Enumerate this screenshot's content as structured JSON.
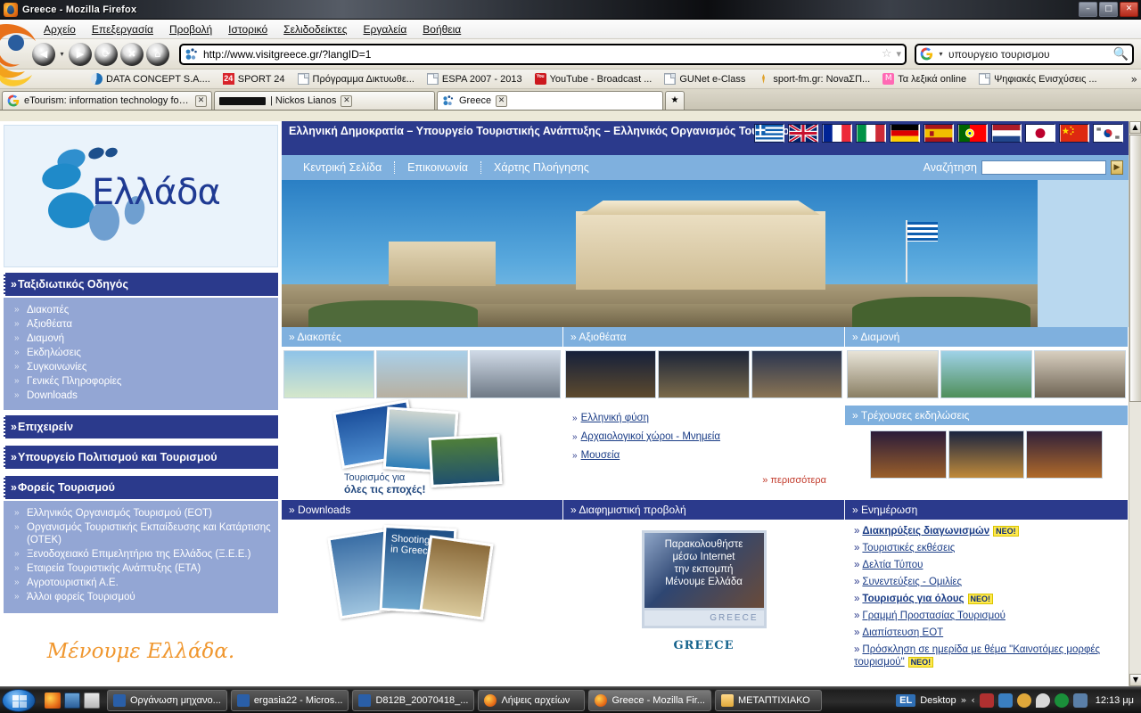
{
  "window": {
    "title": "Greece - Mozilla Firefox",
    "icon": "firefox-icon",
    "minimize": "–",
    "maximize": "□",
    "close": "✕"
  },
  "menubar": {
    "items": [
      {
        "label": "Αρχείο"
      },
      {
        "label": "Επεξεργασία"
      },
      {
        "label": "Προβολή"
      },
      {
        "label": "Ιστορικό"
      },
      {
        "label": "Σελιδοδείκτες"
      },
      {
        "label": "Εργαλεία"
      },
      {
        "label": "Βοήθεια"
      }
    ]
  },
  "navbar": {
    "back": "◀",
    "forward": "▶",
    "reload": "⟳",
    "stop": "✖",
    "home": "⌂",
    "url": "http://www.visitgreece.gr/?langID=1",
    "url_favicon": "visitgreece-favicon",
    "bookmark_star": "☆",
    "dropdown": "▾",
    "search_value": "υπουργειο τουρισμου",
    "search_engine_icon": "google-icon",
    "search_glyph": "🔍"
  },
  "bookmarks": {
    "items": [
      {
        "label": "DATA CONCEPT S.A....",
        "icon": "dataconcept-icon"
      },
      {
        "label": "SPORT 24",
        "icon": "sport24-icon"
      },
      {
        "label": "Πρόγραμμα Δικτυωθε...",
        "icon": "page-icon"
      },
      {
        "label": "ESPA 2007 - 2013",
        "icon": "page-icon"
      },
      {
        "label": "YouTube - Broadcast ...",
        "icon": "youtube-icon"
      },
      {
        "label": "GUNet e-Class",
        "icon": "page-icon"
      },
      {
        "label": "sport-fm.gr: ΝοvaΣΠ...",
        "icon": "pin-icon"
      },
      {
        "label": "Τα λεξικά online",
        "icon": "lexika-icon"
      },
      {
        "label": "Ψηφιακές Ενισχύσεις ...",
        "icon": "page-icon"
      }
    ],
    "overflow": "»"
  },
  "tabs": {
    "items": [
      {
        "label": "eTourism: information technology for ...",
        "active": false,
        "close": "✕",
        "redacted": false
      },
      {
        "label": "| Nickos Lianos",
        "active": false,
        "close": "✕",
        "redacted": true
      },
      {
        "label": "Greece",
        "active": true,
        "close": "✕",
        "redacted": false
      }
    ],
    "list_all": "★"
  },
  "site": {
    "logo_text": "Ελλάδα",
    "title": "Ελληνική Δημοκρατία – Υπουργείο Τουριστικής Ανάπτυξης – Ελληνικός Οργανισμός Τουρισμού",
    "flags": [
      {
        "name": "greece-flag"
      },
      {
        "name": "united-kingdom-flag"
      },
      {
        "name": "france-flag"
      },
      {
        "name": "italy-flag"
      },
      {
        "name": "germany-flag"
      },
      {
        "name": "spain-flag"
      },
      {
        "name": "portugal-flag"
      },
      {
        "name": "netherlands-flag"
      },
      {
        "name": "japan-flag"
      },
      {
        "name": "china-flag"
      },
      {
        "name": "south-korea-flag"
      }
    ],
    "topnav": [
      {
        "label": "Κεντρική Σελίδα"
      },
      {
        "label": "Επικοινωνία"
      },
      {
        "label": "Χάρτης Πλοήγησης"
      }
    ],
    "search_label": "Αναζήτηση",
    "search_value": "",
    "search_button": "▶",
    "slogan": "Μένουμε Ελλάδα."
  },
  "sidebar": {
    "sections": [
      {
        "title": "Ταξιδιωτικός Οδηγός",
        "chev": "»",
        "items": [
          {
            "label": "Διακοπές"
          },
          {
            "label": "Αξιοθέατα"
          },
          {
            "label": "Διαμονή"
          },
          {
            "label": "Εκδηλώσεις"
          },
          {
            "label": "Συγκοινωνίες"
          },
          {
            "label": "Γενικές Πληροφορίες"
          },
          {
            "label": "Downloads"
          }
        ]
      },
      {
        "title": "Επιχειρείν",
        "chev": "»",
        "items": []
      },
      {
        "title": "Υπουργείο Πολιτισμού και Τουρισμού",
        "chev": "»",
        "items": []
      },
      {
        "title": "Φορείς Τουρισμού",
        "chev": "»",
        "items": [
          {
            "label": "Ελληνικός Οργανισμός Τουρισμού (ΕΟΤ)"
          },
          {
            "label": "Οργανισμός Τουριστικής Εκπαίδευσης και Κατάρτισης (ΟΤΕΚ)"
          },
          {
            "label": "Ξενοδοχειακό Επιμελητήριο της Ελλάδος (Ξ.Ε.Ε.)"
          },
          {
            "label": "Εταιρεία Τουριστικής Ανάπτυξης (ΕΤΑ)"
          },
          {
            "label": "Αγροτουριστική Α.Ε."
          },
          {
            "label": "Άλλοι φορείς Τουρισμού"
          }
        ]
      }
    ]
  },
  "main": {
    "row1": [
      {
        "heading": "Διακοπές",
        "chev": "»"
      },
      {
        "heading": "Αξιοθέατα",
        "chev": "»"
      },
      {
        "heading": "Διαμονή",
        "chev": "»"
      }
    ],
    "attractions_links": [
      {
        "label": "Ελληνική φύση"
      },
      {
        "label": "Αρχαιολογικοί χώροι - Μνημεία"
      },
      {
        "label": "Μουσεία"
      }
    ],
    "more_label": "περισσότερα",
    "more_chev": "»",
    "collage_caption_line1": "Τουρισμός για",
    "collage_caption_line2": "όλες τις εποχές!",
    "events_heading": "Τρέχουσες εκδηλώσεις",
    "events_chev": "»",
    "row2": [
      {
        "heading": "Downloads",
        "chev": "»"
      },
      {
        "heading": "Διαφημιστική προβολή",
        "chev": "»"
      },
      {
        "heading": "Ενημέρωση",
        "chev": "»"
      }
    ],
    "ad": {
      "line1": "Παρακολουθήστε",
      "line2": "μέσω Internet",
      "line3": "την εκπομπή",
      "line4": "Μένουμε Ελλάδα",
      "footer_mark": "GREECE",
      "caption": "GREECE"
    },
    "news": [
      {
        "label": "Διακηρύξεις διαγωνισμών",
        "bold": true,
        "badge": "ΝΕΟ!"
      },
      {
        "label": "Τουριστικές εκθέσεις",
        "bold": false,
        "badge": ""
      },
      {
        "label": "Δελτία Τύπου",
        "bold": false,
        "badge": ""
      },
      {
        "label": "Συνεντεύξεις - Ομιλίες",
        "bold": false,
        "badge": ""
      },
      {
        "label": "Τουρισμός για όλους",
        "bold": true,
        "badge": "ΝΕΟ!"
      },
      {
        "label": "Γραμμή Προστασίας Τουρισμού",
        "bold": false,
        "badge": ""
      },
      {
        "label": "Διαπίστευση ΕΟΤ",
        "bold": false,
        "badge": ""
      },
      {
        "label": "Πρόσκληση σε ημερίδα με θέμα \"Καινοτόμες μορφές τουρισμού\"",
        "bold": false,
        "badge": "ΝΕΟ!"
      }
    ],
    "news_chev": "»"
  },
  "scrollbar": {
    "up": "▲",
    "down": "▼"
  },
  "taskbar": {
    "start": "start-orb",
    "quick_launch": [
      {
        "name": "firefox-quicklaunch-icon"
      },
      {
        "name": "show-desktop-icon"
      },
      {
        "name": "calculator-icon"
      }
    ],
    "tasks": [
      {
        "label": "Οργάνωση μηχανο...",
        "icon": "word-document-icon",
        "active": false
      },
      {
        "label": "ergasia22 - Micros...",
        "icon": "word-document-icon",
        "active": false
      },
      {
        "label": "D812B_20070418_...",
        "icon": "word-document-icon",
        "active": false
      },
      {
        "label": "Λήψεις αρχείων",
        "icon": "firefox-icon",
        "active": false
      },
      {
        "label": "Greece - Mozilla Fir...",
        "icon": "firefox-icon",
        "active": true
      },
      {
        "label": "ΜΕΤΑΠΤΙΧΙΑΚΟ",
        "icon": "folder-icon",
        "active": false
      }
    ],
    "language": "EL",
    "desktop_label": "Desktop",
    "chevrons": "»",
    "tray_collapse": "‹",
    "tray_icons": [
      {
        "name": "volume-muted-icon"
      },
      {
        "name": "network-icon"
      },
      {
        "name": "update-icon"
      },
      {
        "name": "messenger-icon"
      },
      {
        "name": "antivirus-icon"
      },
      {
        "name": "chart-icon"
      }
    ],
    "clock": "12:13 μμ"
  }
}
